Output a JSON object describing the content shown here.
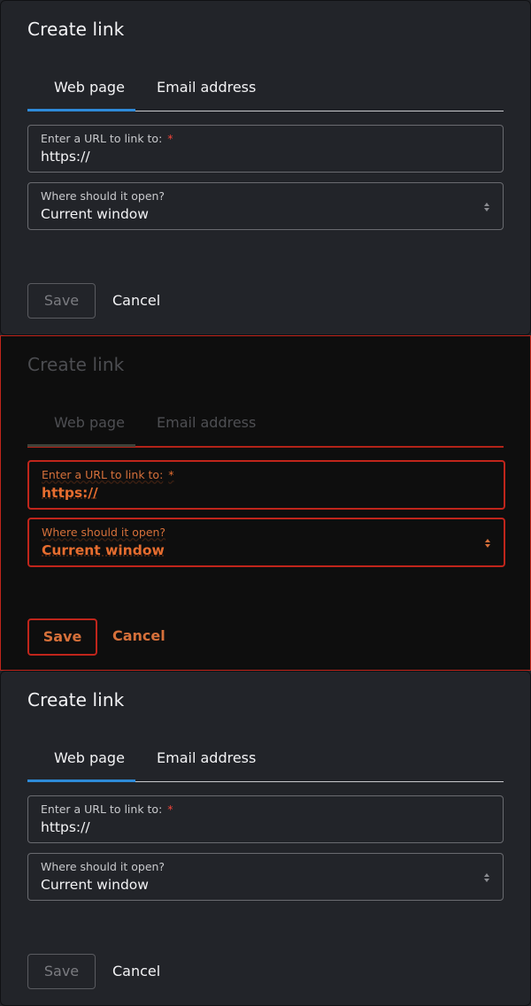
{
  "panels": [
    {
      "title": "Create link",
      "tabs": [
        {
          "label": "Web page",
          "active": true
        },
        {
          "label": "Email address",
          "active": false
        }
      ],
      "url_field": {
        "label": "Enter a URL to link to:",
        "required_mark": "*",
        "value": "https://"
      },
      "open_field": {
        "label": "Where should it open?",
        "value": "Current window"
      },
      "save_label": "Save",
      "cancel_label": "Cancel"
    },
    {
      "title": "Create link",
      "tabs": [
        {
          "label": "Web page",
          "active": true
        },
        {
          "label": "Email address",
          "active": false
        }
      ],
      "url_field": {
        "label": "Enter a URL to link to:",
        "required_mark": "*",
        "value": "https://"
      },
      "open_field": {
        "label": "Where should it open?",
        "value": "Current window"
      },
      "save_label": "Save",
      "cancel_label": "Cancel"
    },
    {
      "title": "Create link",
      "tabs": [
        {
          "label": "Web page",
          "active": true
        },
        {
          "label": "Email address",
          "active": false
        }
      ],
      "url_field": {
        "label": "Enter a URL to link to:",
        "required_mark": "*",
        "value": "https://"
      },
      "open_field": {
        "label": "Where should it open?",
        "value": "Current window"
      },
      "save_label": "Save",
      "cancel_label": "Cancel"
    }
  ],
  "colors": {
    "background": "#222429",
    "accent": "#2e8ad8",
    "required": "#f0443a",
    "diff_outline": "#c0251b",
    "diff_text": "#e66d2f"
  },
  "icons": {
    "select_arrows": "chevron-up-down-icon"
  }
}
